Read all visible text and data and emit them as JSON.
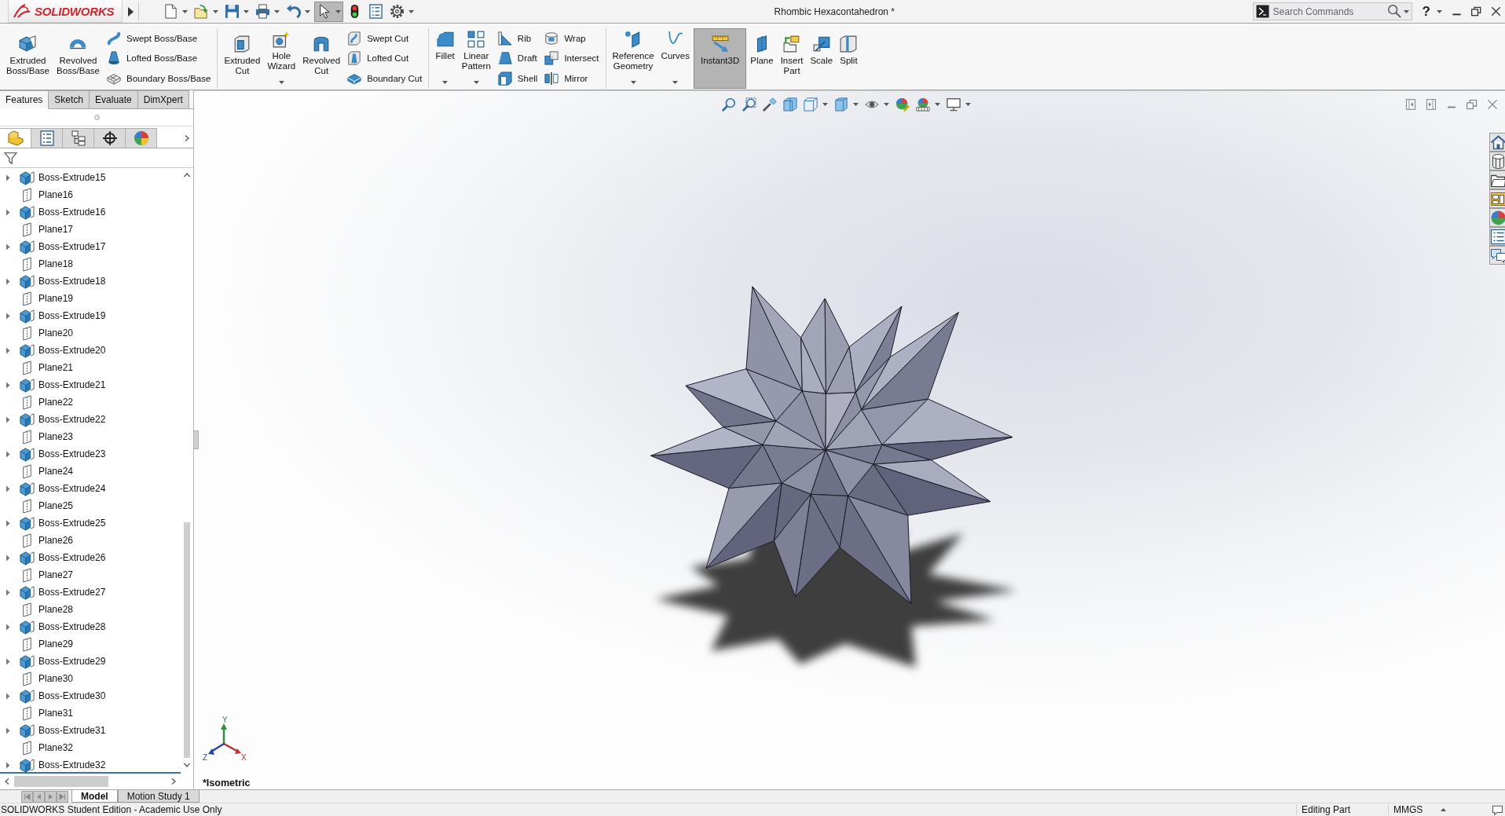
{
  "title_bar": {
    "logo": "SOLIDWORKS",
    "title": "Rhombic Hexacontahedron *",
    "search": {
      "placeholder": "Search Commands"
    },
    "help": "?"
  },
  "quick_access": [
    {
      "dropdown": true,
      "on": false
    },
    {
      "dropdown": true,
      "on": false
    },
    {
      "dropdown": true,
      "on": false
    },
    {
      "dropdown": true,
      "on": false
    },
    {
      "dropdown": true,
      "on": false
    },
    {
      "dropdown": true,
      "on": true
    },
    {
      "dropdown": false,
      "on": false
    },
    {
      "dropdown": false,
      "on": false
    },
    {
      "dropdown": true,
      "on": false
    }
  ],
  "ribbon": {
    "sections": [
      {
        "items": [
          {
            "kind": "large",
            "label": "Extruded\nBoss/Base",
            "dropdown": false,
            "on": false
          },
          {
            "kind": "large",
            "label": "Revolved\nBoss/Base",
            "dropdown": false,
            "on": false
          },
          {
            "kind": "stack",
            "entries": [
              "Swept Boss/Base",
              "Lofted Boss/Base",
              "Boundary Boss/Base"
            ]
          }
        ]
      },
      {
        "items": [
          {
            "kind": "large",
            "label": "Extruded\nCut",
            "dropdown": false,
            "on": false
          },
          {
            "kind": "large",
            "label": "Hole\nWizard",
            "dropdown": true,
            "on": false
          },
          {
            "kind": "large",
            "label": "Revolved\nCut",
            "dropdown": false,
            "on": false
          },
          {
            "kind": "stack",
            "entries": [
              "Swept Cut",
              "Lofted Cut",
              "Boundary Cut"
            ]
          }
        ]
      },
      {
        "items": [
          {
            "kind": "large",
            "label": "Fillet",
            "dropdown": true,
            "on": false
          },
          {
            "kind": "large",
            "label": "Linear\nPattern",
            "dropdown": true,
            "on": false
          },
          {
            "kind": "stack",
            "entries": [
              "Rib",
              "Draft",
              "Shell"
            ]
          },
          {
            "kind": "stack",
            "entries": [
              "Wrap",
              "Intersect",
              "Mirror"
            ]
          }
        ]
      },
      {
        "items": [
          {
            "kind": "large",
            "label": "Reference\nGeometry",
            "dropdown": true,
            "on": false
          },
          {
            "kind": "large",
            "label": "Curves",
            "dropdown": true,
            "on": false
          },
          {
            "kind": "large",
            "label": "Instant3D",
            "dropdown": false,
            "on": true
          },
          {
            "kind": "large",
            "label": "Plane",
            "dropdown": false,
            "on": false
          },
          {
            "kind": "large",
            "label": "Insert\nPart",
            "dropdown": false,
            "on": false
          },
          {
            "kind": "large",
            "label": "Scale",
            "dropdown": false,
            "on": false
          },
          {
            "kind": "large",
            "label": "Split",
            "dropdown": false,
            "on": false
          }
        ]
      }
    ]
  },
  "command_tabs": [
    {
      "label": "Features",
      "selected": true
    },
    {
      "label": "Sketch",
      "selected": false
    },
    {
      "label": "Evaluate",
      "selected": false
    },
    {
      "label": "DimXpert",
      "selected": false
    }
  ],
  "panel_tabs": [
    {
      "selected": true
    },
    {
      "selected": false
    },
    {
      "selected": false
    },
    {
      "selected": false
    },
    {
      "selected": false
    }
  ],
  "tree": {
    "items": [
      {
        "kind": "feature",
        "label": "Boss-Extrude15",
        "expanded": false
      },
      {
        "kind": "plane",
        "label": "Plane16"
      },
      {
        "kind": "feature",
        "label": "Boss-Extrude16",
        "expanded": false
      },
      {
        "kind": "plane",
        "label": "Plane17"
      },
      {
        "kind": "feature",
        "label": "Boss-Extrude17",
        "expanded": false
      },
      {
        "kind": "plane",
        "label": "Plane18"
      },
      {
        "kind": "feature",
        "label": "Boss-Extrude18",
        "expanded": false
      },
      {
        "kind": "plane",
        "label": "Plane19"
      },
      {
        "kind": "feature",
        "label": "Boss-Extrude19",
        "expanded": false
      },
      {
        "kind": "plane",
        "label": "Plane20"
      },
      {
        "kind": "feature",
        "label": "Boss-Extrude20",
        "expanded": false
      },
      {
        "kind": "plane",
        "label": "Plane21"
      },
      {
        "kind": "feature",
        "label": "Boss-Extrude21",
        "expanded": false
      },
      {
        "kind": "plane",
        "label": "Plane22"
      },
      {
        "kind": "feature",
        "label": "Boss-Extrude22",
        "expanded": false
      },
      {
        "kind": "plane",
        "label": "Plane23"
      },
      {
        "kind": "feature",
        "label": "Boss-Extrude23",
        "expanded": false
      },
      {
        "kind": "plane",
        "label": "Plane24"
      },
      {
        "kind": "feature",
        "label": "Boss-Extrude24",
        "expanded": false
      },
      {
        "kind": "plane",
        "label": "Plane25"
      },
      {
        "kind": "feature",
        "label": "Boss-Extrude25",
        "expanded": false
      },
      {
        "kind": "plane",
        "label": "Plane26"
      },
      {
        "kind": "feature",
        "label": "Boss-Extrude26",
        "expanded": false
      },
      {
        "kind": "plane",
        "label": "Plane27"
      },
      {
        "kind": "feature",
        "label": "Boss-Extrude27",
        "expanded": false
      },
      {
        "kind": "plane",
        "label": "Plane28"
      },
      {
        "kind": "feature",
        "label": "Boss-Extrude28",
        "expanded": false
      },
      {
        "kind": "plane",
        "label": "Plane29"
      },
      {
        "kind": "feature",
        "label": "Boss-Extrude29",
        "expanded": false
      },
      {
        "kind": "plane",
        "label": "Plane30"
      },
      {
        "kind": "feature",
        "label": "Boss-Extrude30",
        "expanded": false
      },
      {
        "kind": "plane",
        "label": "Plane31"
      },
      {
        "kind": "feature",
        "label": "Boss-Extrude31",
        "expanded": false
      },
      {
        "kind": "plane",
        "label": "Plane32"
      },
      {
        "kind": "feature",
        "label": "Boss-Extrude32",
        "expanded": false
      }
    ]
  },
  "viewport": {
    "view_name": "*Isometric",
    "triad": {
      "x": "X",
      "y": "Y",
      "z": "Z"
    }
  },
  "bottom_tabs": [
    {
      "label": "Model",
      "selected": true
    },
    {
      "label": "Motion Study 1",
      "selected": false
    }
  ],
  "status_bar": {
    "edition": "SOLIDWORKS Student Edition - Academic Use Only",
    "mode": "Editing Part",
    "units": "MMGS"
  }
}
